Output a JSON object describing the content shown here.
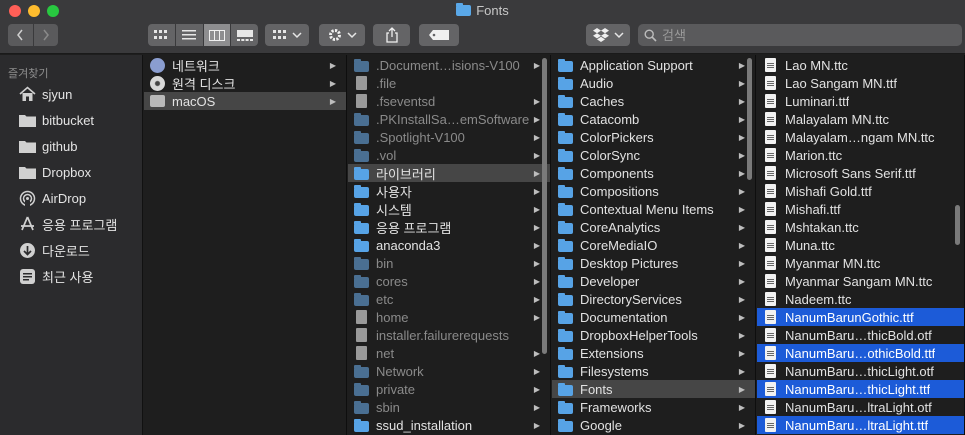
{
  "window": {
    "title": "Fonts"
  },
  "toolbar": {
    "search_placeholder": "검색",
    "nav": {
      "back": "back",
      "forward": "forward"
    }
  },
  "sidebar": {
    "heading": "즐겨찾기",
    "items": [
      {
        "label": "sjyun",
        "icon": "home-icon"
      },
      {
        "label": "bitbucket",
        "icon": "folder-icon"
      },
      {
        "label": "github",
        "icon": "folder-icon"
      },
      {
        "label": "Dropbox",
        "icon": "dropbox-icon"
      },
      {
        "label": "AirDrop",
        "icon": "airdrop-icon"
      },
      {
        "label": "응용 프로그램",
        "icon": "applications-icon"
      },
      {
        "label": "다운로드",
        "icon": "download-icon"
      },
      {
        "label": "최근 사용",
        "icon": "recent-icon"
      }
    ]
  },
  "columns": [
    {
      "rows": [
        {
          "label": "네트워크",
          "icon": "globe",
          "arrow": true
        },
        {
          "label": "원격 디스크",
          "icon": "cd",
          "arrow": true
        },
        {
          "label": "macOS",
          "icon": "disk",
          "arrow": true,
          "state": "selected-gray"
        }
      ]
    },
    {
      "rows": [
        {
          "label": ".Document…isions-V100",
          "icon": "folder",
          "dim": true,
          "arrow": true
        },
        {
          "label": ".file",
          "icon": "docd",
          "dim": true
        },
        {
          "label": ".fseventsd",
          "icon": "docd",
          "dim": true,
          "arrow": true
        },
        {
          "label": ".PKInstallSa…emSoftware",
          "icon": "folder",
          "dim": true,
          "arrow": true
        },
        {
          "label": ".Spotlight-V100",
          "icon": "folder",
          "dim": true,
          "arrow": true
        },
        {
          "label": ".vol",
          "icon": "folder",
          "dim": true,
          "arrow": true
        },
        {
          "label": "라이브러리",
          "icon": "folder",
          "arrow": true,
          "state": "selected-gray"
        },
        {
          "label": "사용자",
          "icon": "folder",
          "arrow": true
        },
        {
          "label": "시스템",
          "icon": "folder",
          "arrow": true
        },
        {
          "label": "응용 프로그램",
          "icon": "folder",
          "arrow": true
        },
        {
          "label": "anaconda3",
          "icon": "folder",
          "arrow": true
        },
        {
          "label": "bin",
          "icon": "folder",
          "dim": true,
          "arrow": true
        },
        {
          "label": "cores",
          "icon": "folder",
          "dim": true,
          "arrow": true
        },
        {
          "label": "etc",
          "icon": "folder",
          "dim": true,
          "arrow": true
        },
        {
          "label": "home",
          "icon": "docd",
          "dim": true,
          "arrow": true
        },
        {
          "label": "installer.failurerequests",
          "icon": "docd",
          "dim": true
        },
        {
          "label": "net",
          "icon": "docd",
          "dim": true,
          "arrow": true
        },
        {
          "label": "Network",
          "icon": "folder",
          "dim": true,
          "arrow": true
        },
        {
          "label": "private",
          "icon": "folder",
          "dim": true,
          "arrow": true
        },
        {
          "label": "sbin",
          "icon": "folder",
          "dim": true,
          "arrow": true
        },
        {
          "label": "ssud_installation",
          "icon": "folder",
          "arrow": true
        }
      ]
    },
    {
      "rows": [
        {
          "label": "Application Support",
          "icon": "folder",
          "arrow": true
        },
        {
          "label": "Audio",
          "icon": "folder",
          "arrow": true
        },
        {
          "label": "Caches",
          "icon": "folder",
          "arrow": true
        },
        {
          "label": "Catacomb",
          "icon": "folder",
          "arrow": true
        },
        {
          "label": "ColorPickers",
          "icon": "folder",
          "arrow": true
        },
        {
          "label": "ColorSync",
          "icon": "folder",
          "arrow": true
        },
        {
          "label": "Components",
          "icon": "folder",
          "arrow": true
        },
        {
          "label": "Compositions",
          "icon": "folder",
          "arrow": true
        },
        {
          "label": "Contextual Menu Items",
          "icon": "folder",
          "arrow": true
        },
        {
          "label": "CoreAnalytics",
          "icon": "folder",
          "arrow": true
        },
        {
          "label": "CoreMediaIO",
          "icon": "folder",
          "arrow": true
        },
        {
          "label": "Desktop Pictures",
          "icon": "folder",
          "arrow": true
        },
        {
          "label": "Developer",
          "icon": "folder",
          "arrow": true
        },
        {
          "label": "DirectoryServices",
          "icon": "folder",
          "arrow": true
        },
        {
          "label": "Documentation",
          "icon": "folder",
          "arrow": true
        },
        {
          "label": "DropboxHelperTools",
          "icon": "folder",
          "arrow": true
        },
        {
          "label": "Extensions",
          "icon": "folder",
          "arrow": true
        },
        {
          "label": "Filesystems",
          "icon": "folder",
          "arrow": true
        },
        {
          "label": "Fonts",
          "icon": "folder",
          "arrow": true,
          "state": "selected-gray"
        },
        {
          "label": "Frameworks",
          "icon": "folder",
          "arrow": true
        },
        {
          "label": "Google",
          "icon": "folder",
          "arrow": true
        }
      ]
    },
    {
      "rows": [
        {
          "label": "Lao MN.ttc",
          "icon": "doc"
        },
        {
          "label": "Lao Sangam MN.ttf",
          "icon": "doc"
        },
        {
          "label": "Luminari.ttf",
          "icon": "doc"
        },
        {
          "label": "Malayalam MN.ttc",
          "icon": "doc"
        },
        {
          "label": "Malayalam…ngam MN.ttc",
          "icon": "doc"
        },
        {
          "label": "Marion.ttc",
          "icon": "doc"
        },
        {
          "label": "Microsoft Sans Serif.ttf",
          "icon": "doc"
        },
        {
          "label": "Mishafi Gold.ttf",
          "icon": "doc"
        },
        {
          "label": "Mishafi.ttf",
          "icon": "doc"
        },
        {
          "label": "Mshtakan.ttc",
          "icon": "doc"
        },
        {
          "label": "Muna.ttc",
          "icon": "doc"
        },
        {
          "label": "Myanmar MN.ttc",
          "icon": "doc"
        },
        {
          "label": "Myanmar Sangam MN.ttc",
          "icon": "doc"
        },
        {
          "label": "Nadeem.ttc",
          "icon": "doc"
        },
        {
          "label": "NanumBarunGothic.ttf",
          "icon": "doc",
          "state": "selected-blue"
        },
        {
          "label": "NanumBaru…thicBold.otf",
          "icon": "doc"
        },
        {
          "label": "NanumBaru…othicBold.ttf",
          "icon": "doc",
          "state": "selected-blue"
        },
        {
          "label": "NanumBaru…thicLight.otf",
          "icon": "doc"
        },
        {
          "label": "NanumBaru…thicLight.ttf",
          "icon": "doc",
          "state": "selected-blue"
        },
        {
          "label": "NanumBaru…ltraLight.otf",
          "icon": "doc"
        },
        {
          "label": "NanumBaru…ltraLight.ttf",
          "icon": "doc",
          "state": "selected-blue"
        }
      ]
    }
  ]
}
